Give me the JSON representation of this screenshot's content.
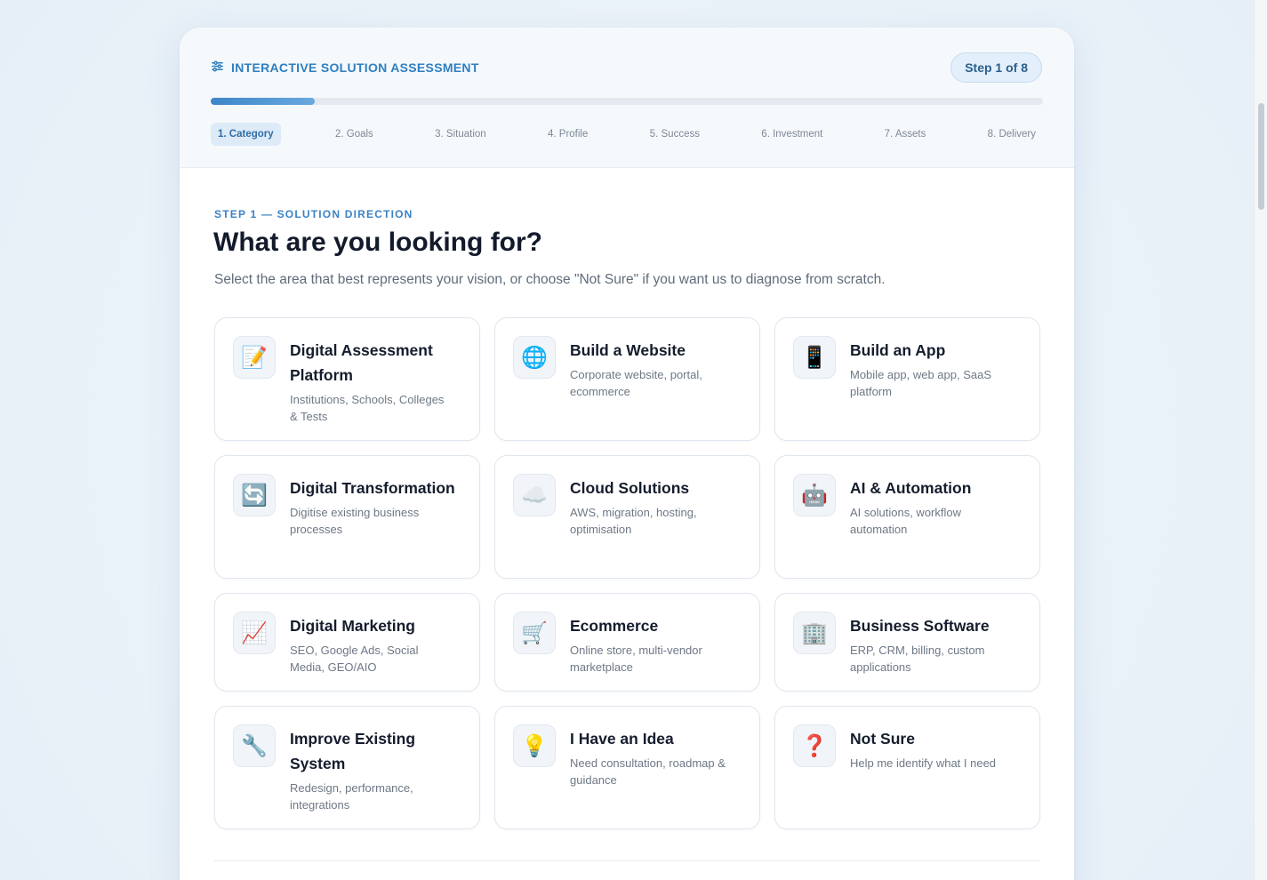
{
  "header": {
    "title": "INTERACTIVE SOLUTION ASSESSMENT",
    "title_icon": "sliders-icon",
    "step_badge": "Step 1 of 8",
    "progress": 0.125,
    "steps": [
      "1. Category",
      "2. Goals",
      "3. Situation",
      "4. Profile",
      "5. Success",
      "6. Investment",
      "7. Assets",
      "8. Delivery"
    ],
    "active_step": 0
  },
  "main": {
    "kicker": "STEP 1 — SOLUTION DIRECTION",
    "heading": "What are you looking for?",
    "subtext": "Select the area that best represents your vision, or choose \"Not Sure\" if you want us to diagnose from scratch."
  },
  "options": [
    {
      "icon": "📝",
      "icon_name": "memo-icon",
      "title": "Digital Assessment Platform",
      "desc": "Institutions, Schools, Colleges & Tests"
    },
    {
      "icon": "🌐",
      "icon_name": "globe-icon",
      "title": "Build a Website",
      "desc": "Corporate website, portal, ecommerce"
    },
    {
      "icon": "📱",
      "icon_name": "mobile-phone-icon",
      "title": "Build an App",
      "desc": "Mobile app, web app, SaaS platform"
    },
    {
      "icon": "🔄",
      "icon_name": "refresh-icon",
      "title": "Digital Transformation",
      "desc": "Digitise existing business processes"
    },
    {
      "icon": "☁️",
      "icon_name": "cloud-icon",
      "title": "Cloud Solutions",
      "desc": "AWS, migration, hosting, optimisation"
    },
    {
      "icon": "🤖",
      "icon_name": "robot-icon",
      "title": "AI & Automation",
      "desc": "AI solutions, workflow automation"
    },
    {
      "icon": "📈",
      "icon_name": "chart-increasing-icon",
      "title": "Digital Marketing",
      "desc": "SEO, Google Ads, Social Media, GEO/AIO"
    },
    {
      "icon": "🛒",
      "icon_name": "shopping-cart-icon",
      "title": "Ecommerce",
      "desc": "Online store, multi-vendor marketplace"
    },
    {
      "icon": "🏢",
      "icon_name": "office-building-icon",
      "title": "Business Software",
      "desc": "ERP, CRM, billing, custom applications"
    },
    {
      "icon": "🔧",
      "icon_name": "wrench-icon",
      "title": "Improve Existing System",
      "desc": "Redesign, performance, integrations"
    },
    {
      "icon": "💡",
      "icon_name": "light-bulb-icon",
      "title": "I Have an Idea",
      "desc": "Need consultation, roadmap & guidance"
    },
    {
      "icon": "❓",
      "icon_name": "question-mark-icon",
      "title": "Not Sure",
      "desc": "Help me identify what I need"
    }
  ],
  "colors": {
    "accent": "#2f7fc0",
    "heading": "#121a2b",
    "muted": "#6e7886",
    "active_step_bg": "#ddeaf7"
  }
}
